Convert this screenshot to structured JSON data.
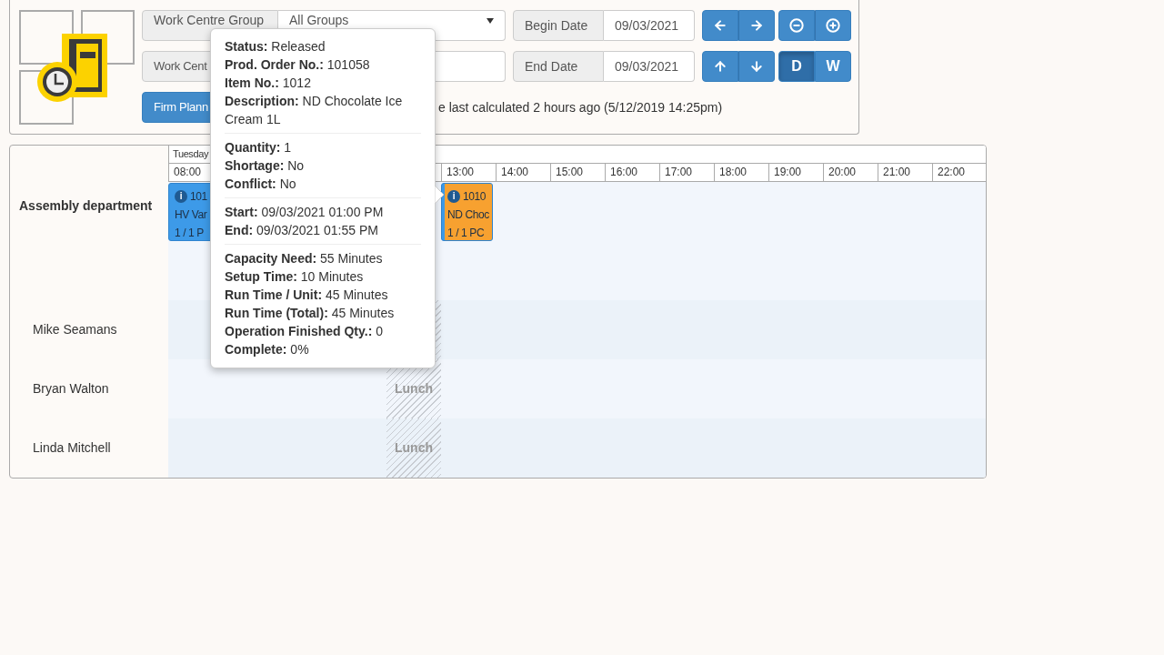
{
  "filters": {
    "group_label": "Work Centre Group",
    "group_value": "All Groups",
    "centre_label": "Work Cent",
    "begin_label": "Begin Date",
    "begin_value": "09/03/2021",
    "end_label": "End Date",
    "end_value": "09/03/2021"
  },
  "firm_button": "Firm Plann",
  "calc_message": "e last calculated 2 hours ago (5/12/2019 14:25pm)",
  "view_modes": [
    {
      "label": "D",
      "selected": true
    },
    {
      "label": "W",
      "selected": false
    }
  ],
  "timeline": {
    "day": "Tuesday",
    "hours_left": [
      "08:00"
    ],
    "hours_right": [
      "13:00",
      "14:00",
      "15:00",
      "16:00",
      "17:00",
      "18:00",
      "19:00",
      "20:00",
      "21:00",
      "22:00"
    ],
    "rows": [
      {
        "kind": "group",
        "label": "Assembly department",
        "lunch": false,
        "events": [
          {
            "color": "#3d9ae8",
            "icon": "i",
            "lines": [
              "101",
              "HV Var",
              "1 / 1 P"
            ]
          },
          {
            "color": "#f7a130",
            "icon": "i",
            "lines": [
              "1010",
              "ND Choc",
              "1 / 1 PC"
            ]
          }
        ]
      },
      {
        "kind": "resource",
        "label": "Mike Seamans",
        "lunch": true
      },
      {
        "kind": "resource",
        "label": "Bryan Walton",
        "lunch": true,
        "lunch_label": "Lunch"
      },
      {
        "kind": "resource",
        "label": "Linda Mitchell",
        "lunch": true,
        "lunch_label": "Lunch"
      }
    ]
  },
  "tooltip": {
    "sections": [
      [
        {
          "label": "Status:",
          "value": "Released"
        },
        {
          "label": "Prod. Order No.:",
          "value": "101058"
        },
        {
          "label": "Item No.:",
          "value": "1012"
        },
        {
          "label": "Description:",
          "value": "ND Chocolate Ice Cream 1L"
        }
      ],
      [
        {
          "label": "Quantity:",
          "value": "1"
        },
        {
          "label": "Shortage:",
          "value": "No"
        },
        {
          "label": "Conflict:",
          "value": "No"
        }
      ],
      [
        {
          "label": "Start:",
          "value": "09/03/2021 01:00 PM"
        },
        {
          "label": "End:",
          "value": "09/03/2021 01:55 PM"
        }
      ],
      [
        {
          "label": "Capacity Need:",
          "value": "55 Minutes"
        },
        {
          "label": "Setup Time:",
          "value": "10 Minutes"
        },
        {
          "label": "Run Time / Unit:",
          "value": "45 Minutes"
        },
        {
          "label": "Run Time (Total):",
          "value": "45 Minutes"
        },
        {
          "label": "Operation Finished Qty.:",
          "value": "0"
        },
        {
          "label": "Complete:",
          "value": "0%"
        }
      ]
    ]
  }
}
